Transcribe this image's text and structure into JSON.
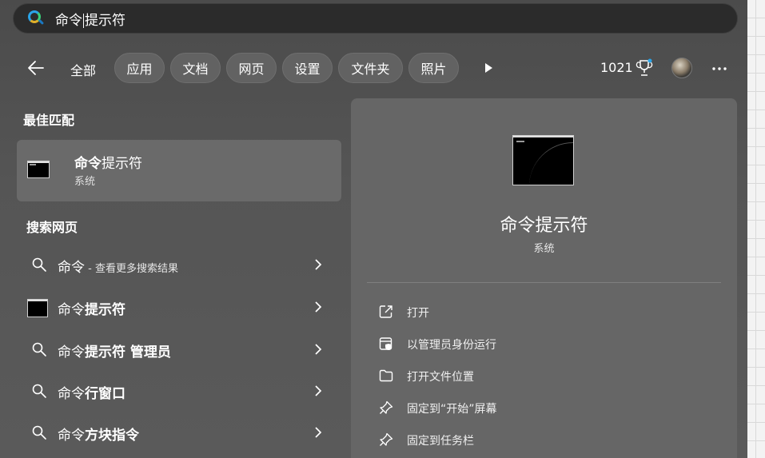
{
  "search": {
    "query_before_caret": "命令",
    "query_after_caret": "提示符"
  },
  "filters": {
    "all_label": "全部",
    "chips": [
      "应用",
      "文档",
      "网页",
      "设置",
      "文件夹",
      "照片"
    ],
    "points": "1021"
  },
  "best_match": {
    "section_title": "最佳匹配",
    "title_bold": "命令",
    "title_rest": "提示符",
    "subtitle": "系统"
  },
  "web_search": {
    "section_title": "搜索网页",
    "items": [
      {
        "plain": "命令",
        "bold": "",
        "suffix": " - 查看更多搜索结果",
        "icon": "search-icon"
      },
      {
        "plain": "命令",
        "bold": "提示符",
        "suffix": "",
        "icon": "cmd-icon"
      },
      {
        "plain": "命令",
        "bold": "提示符 管理员",
        "suffix": "",
        "icon": "search-icon"
      },
      {
        "plain": "命令",
        "bold": "行窗口",
        "suffix": "",
        "icon": "search-icon"
      },
      {
        "plain": "命令",
        "bold": "方块指令",
        "suffix": "",
        "icon": "search-icon"
      }
    ]
  },
  "detail": {
    "name": "命令提示符",
    "subtitle": "系统",
    "actions": [
      {
        "label": "打开",
        "icon": "open-external-icon"
      },
      {
        "label": "以管理员身份运行",
        "icon": "shield-admin-icon"
      },
      {
        "label": "打开文件位置",
        "icon": "folder-icon"
      },
      {
        "label": "固定到“开始”屏幕",
        "icon": "pin-icon"
      },
      {
        "label": "固定到任务栏",
        "icon": "pin-icon"
      }
    ]
  },
  "colors": {
    "accent_blue": "#2aa4e8",
    "panel_bg": "#555555",
    "selected_bg": "#6a6a6a"
  }
}
